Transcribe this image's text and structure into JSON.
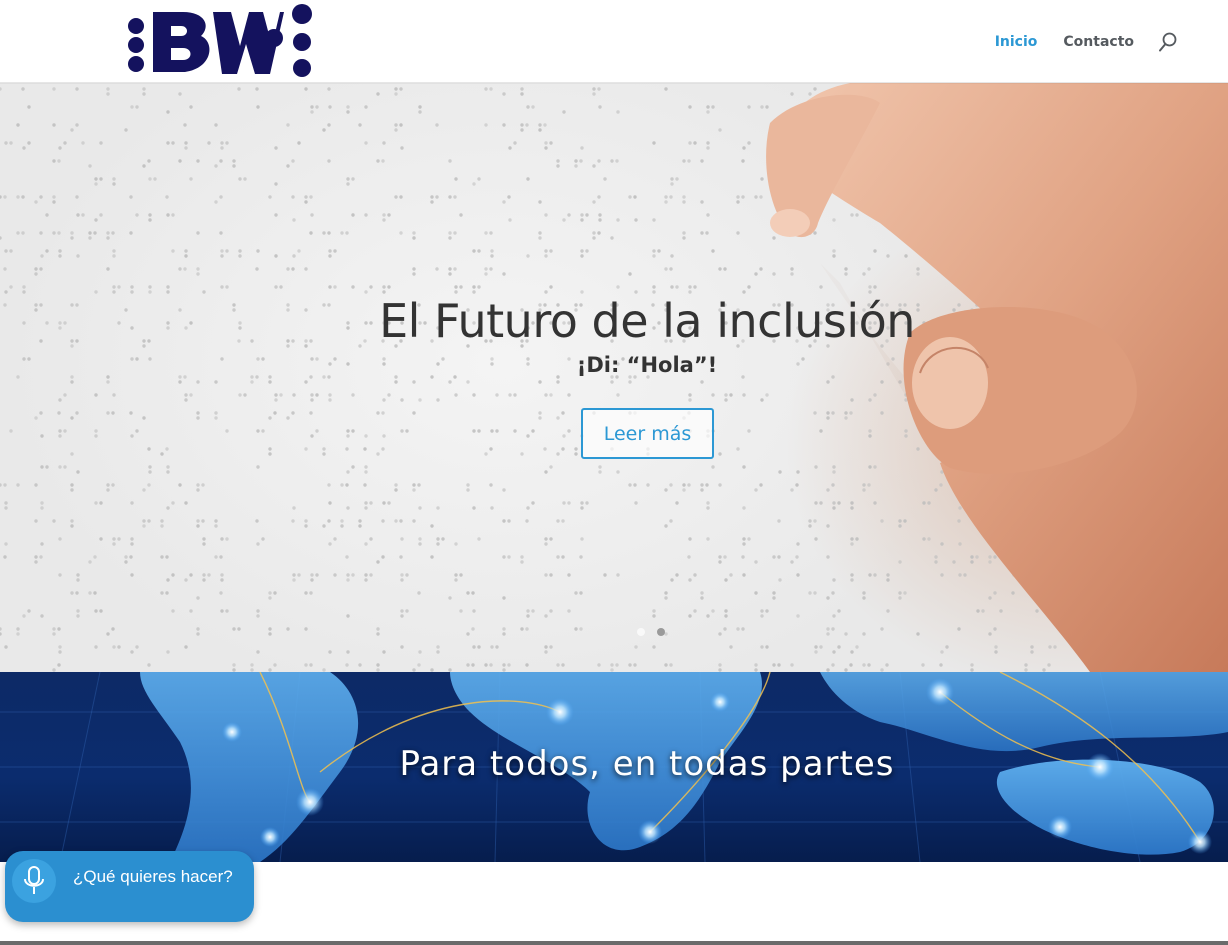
{
  "header": {
    "logo_text": "BW",
    "nav": [
      {
        "label": "Inicio",
        "active": true
      },
      {
        "label": "Contacto",
        "active": false
      }
    ],
    "search_icon": "search-icon"
  },
  "hero": {
    "title": "El Futuro de la inclusión",
    "subtitle": "¡Di: “Hola”!",
    "button_label": "Leer más",
    "slide_dots": {
      "count": 2,
      "active_index": 1
    }
  },
  "world_band": {
    "title": "Para todos, en todas partes"
  },
  "voice_widget": {
    "label": "¿Qué quieres hacer?",
    "icon": "microphone-icon"
  },
  "colors": {
    "accent": "#2c98d4",
    "nav_text": "#555a5f",
    "logo_navy": "#14125e",
    "voice_bg": "#2b8fd0",
    "world_bg": "#0b2c6e"
  }
}
